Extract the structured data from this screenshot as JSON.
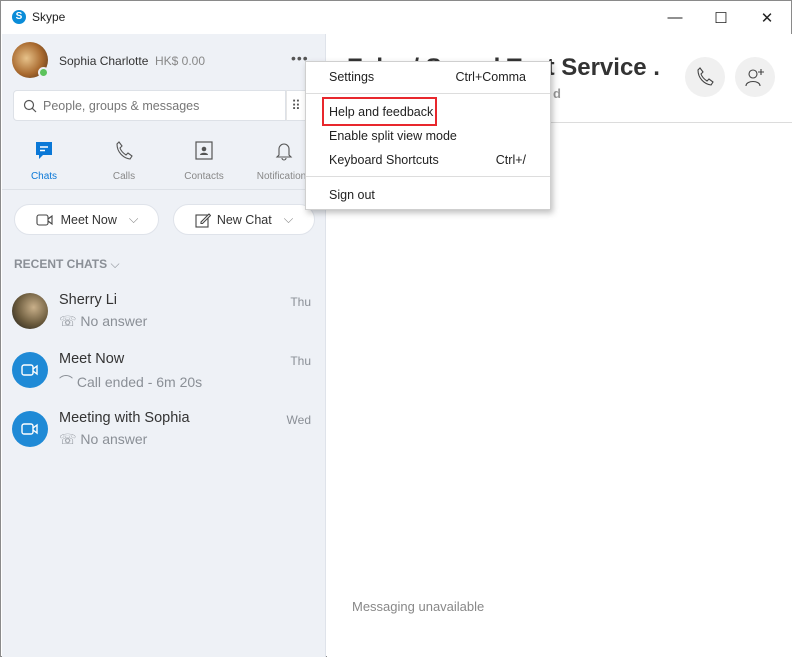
{
  "window": {
    "title": "Skype",
    "controls": [
      "minimize",
      "maximize",
      "close"
    ]
  },
  "profile": {
    "name": "Sophia Charlotte",
    "credit": "HK$ 0.00",
    "status": "online"
  },
  "search": {
    "placeholder": "People, groups & messages"
  },
  "nav": [
    {
      "label": "Chats",
      "icon": "chat-icon",
      "active": true
    },
    {
      "label": "Calls",
      "icon": "phone-icon"
    },
    {
      "label": "Contacts",
      "icon": "contacts-icon"
    },
    {
      "label": "Notifications",
      "icon": "bell-icon"
    }
  ],
  "actions": {
    "meet_now": "Meet Now",
    "new_chat": "New Chat"
  },
  "recent": {
    "header": "RECENT CHATS",
    "items": [
      {
        "name": "Sherry Li",
        "status": "No answer",
        "date": "Thu"
      },
      {
        "name": "Meet Now",
        "status": "Call ended - 6m 20s",
        "date": "Thu"
      },
      {
        "name": "Meeting with Sophia",
        "status": "No answer",
        "date": "Wed"
      }
    ]
  },
  "conversation": {
    "title": "Echo / Sound Test Service .",
    "subtitle_fragment": "d",
    "message": "Messaging unavailable"
  },
  "menu": {
    "items": [
      {
        "label": "Settings",
        "shortcut": "Ctrl+Comma"
      },
      {
        "label": "Help and feedback",
        "shortcut": "",
        "highlighted": true
      },
      {
        "label": "Enable split view mode",
        "shortcut": ""
      },
      {
        "label": "Keyboard Shortcuts",
        "shortcut": "Ctrl+/"
      },
      {
        "label": "Sign out",
        "shortcut": ""
      }
    ]
  },
  "colors": {
    "accent": "#0a78d7",
    "highlight": "#e8272d",
    "sidebar_bg": "#eef1f6"
  }
}
